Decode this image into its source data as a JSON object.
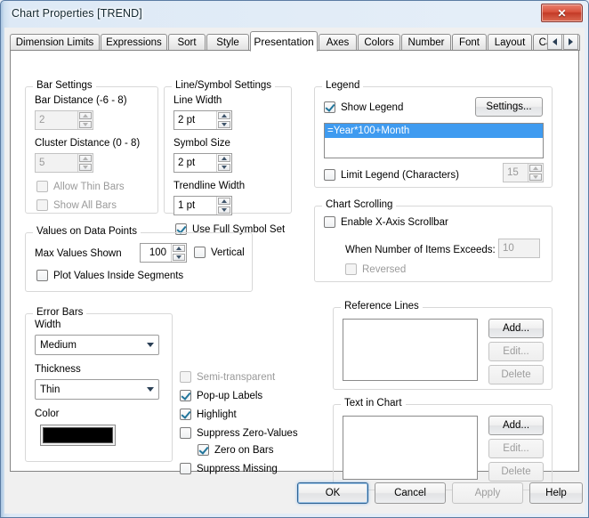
{
  "window": {
    "title": "Chart Properties [TREND]",
    "close_icon": "close-icon",
    "close_glyph": "✕",
    "accent_selection": "#3f9bf0",
    "close_button_color": "#c33a26"
  },
  "tabs": {
    "items": [
      {
        "label": "Dimension Limits",
        "selected": false
      },
      {
        "label": "Expressions",
        "selected": false
      },
      {
        "label": "Sort",
        "selected": false
      },
      {
        "label": "Style",
        "selected": false
      },
      {
        "label": "Presentation",
        "selected": true
      },
      {
        "label": "Axes",
        "selected": false
      },
      {
        "label": "Colors",
        "selected": false
      },
      {
        "label": "Number",
        "selected": false
      },
      {
        "label": "Font",
        "selected": false
      },
      {
        "label": "Layout",
        "selected": false
      },
      {
        "label": "Caption",
        "selected": false
      }
    ],
    "nav_prev": "scroll-tabs-left",
    "nav_next": "scroll-tabs-right"
  },
  "bar_settings": {
    "title": "Bar Settings",
    "bar_distance_label": "Bar Distance (-6 - 8)",
    "bar_distance_value": "2",
    "cluster_distance_label": "Cluster Distance (0 - 8)",
    "cluster_distance_value": "5",
    "allow_thin_bars": "Allow Thin Bars",
    "show_all_bars": "Show All Bars"
  },
  "line_symbol_settings": {
    "title": "Line/Symbol Settings",
    "line_width_label": "Line Width",
    "line_width_value": "2 pt",
    "symbol_size_label": "Symbol Size",
    "symbol_size_value": "2 pt",
    "trendline_width_label": "Trendline Width",
    "trendline_width_value": "1 pt",
    "use_full_symbol_set": "Use Full Symbol Set"
  },
  "values_on_data_points": {
    "title": "Values on Data Points",
    "max_values_label": "Max Values Shown",
    "max_values_value": "100",
    "vertical": "Vertical",
    "plot_values_inside_segments": "Plot Values Inside Segments"
  },
  "error_bars": {
    "title": "Error Bars",
    "width_label": "Width",
    "width_value": "Medium",
    "thickness_label": "Thickness",
    "thickness_value": "Thin",
    "color_label": "Color",
    "color_value": "#000000"
  },
  "options": {
    "semi_transparent": "Semi-transparent",
    "popup_labels": "Pop-up Labels",
    "highlight": "Highlight",
    "suppress_zero_values": "Suppress Zero-Values",
    "zero_on_bars": "Zero on Bars",
    "suppress_missing": "Suppress Missing"
  },
  "legend": {
    "title": "Legend",
    "show_legend": "Show Legend",
    "settings_button": "Settings...",
    "items": [
      "=Year*100+Month"
    ],
    "limit_legend": "Limit Legend (Characters)",
    "limit_value": "15"
  },
  "chart_scrolling": {
    "title": "Chart Scrolling",
    "enable_scrollbar": "Enable X-Axis Scrollbar",
    "when_exceeds_label": "When Number of Items Exceeds:",
    "when_exceeds_value": "10",
    "reversed": "Reversed"
  },
  "reference_lines": {
    "title": "Reference Lines",
    "items": [],
    "add_button": "Add...",
    "edit_button": "Edit...",
    "delete_button": "Delete"
  },
  "text_in_chart": {
    "title": "Text in Chart",
    "items": [],
    "add_button": "Add...",
    "edit_button": "Edit...",
    "delete_button": "Delete"
  },
  "footer": {
    "ok": "OK",
    "cancel": "Cancel",
    "apply": "Apply",
    "help": "Help"
  }
}
